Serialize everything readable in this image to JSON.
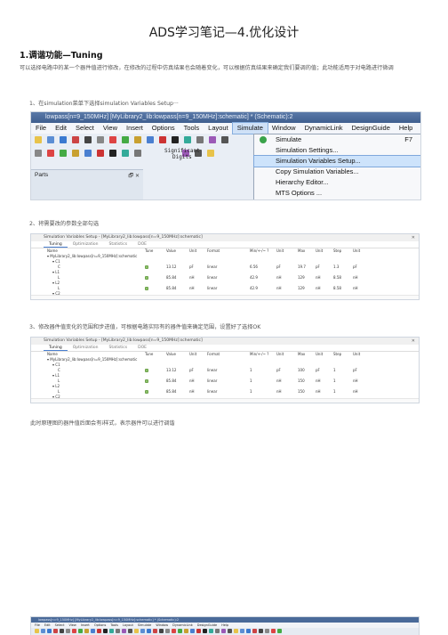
{
  "document": {
    "title": "ADS学习笔记—4.优化设计",
    "section1_heading": "1.调谐功能—Tuning",
    "intro": "可以选择电路中的某一个器件值进行修改，在修改的过程中仿真结果也会随着变化，可以根据仿真结果来确定我们要调的值；此功能适用于对电路进行微调",
    "step1": "1、在simulation菜单下选择simulation Variables Setup···",
    "step2": "2、将需要改的参数全部勾选",
    "step3": "3、修改器件值变化的范围和步进值，可根据电路实际有的器件值来确定范围，设置好了选择OK",
    "note4": "此时原理图的器件值后面会有i样式，表示器件可以进行调谐"
  },
  "screenshot1": {
    "window_title": "lowpass[n=9_150MHz] [MyLibrary2_lib:lowpass[n=9_150MHz]:schematic] * (Schematic):2",
    "menus": [
      "File",
      "Edit",
      "Select",
      "View",
      "Insert",
      "Options",
      "Tools",
      "Layout",
      "Simulate",
      "Window",
      "DynamicLink",
      "DesignGuide",
      "Help"
    ],
    "active_menu": "Simulate",
    "significant_digits": [
      "Significant",
      "Digits"
    ],
    "parts_label": "Parts",
    "parts_controls": "🗗 ✕",
    "simulate_menu": [
      {
        "label": "Simulate",
        "shortcut": "F7"
      },
      {
        "label": "Simulation Settings...",
        "shortcut": ""
      },
      {
        "label": "Simulation Variables Setup...",
        "shortcut": ""
      },
      {
        "label": "Copy Simulation Variables...",
        "shortcut": ""
      },
      {
        "label": "Hierarchy Editor...",
        "shortcut": ""
      },
      {
        "label": "MTS Options ...",
        "shortcut": ""
      }
    ],
    "highlighted_item": "Simulation Variables Setup..."
  },
  "dialog": {
    "title": "Simulation Variables Setup - [MyLibrary2_lib:lowpass[n=9_150MHz]:schematic]",
    "tabs": [
      "Tuning",
      "Optimization",
      "Statistics",
      "DOE"
    ],
    "active_tab": "Tuning",
    "columns": [
      "Name",
      "Tune",
      "Value",
      "Unit",
      "Format",
      "Min/+-/~ ?",
      "Unit",
      "Max",
      "Unit",
      "Step",
      "Unit"
    ],
    "tree_root": "MyLibrary2_lib:lowpass[n=9_150MHz]:schematic"
  },
  "screenshot2": {
    "rows": [
      {
        "name": "C1",
        "indent": 1,
        "tune": null,
        "value": "",
        "unit": "",
        "format": "",
        "min": "",
        "minunit": "",
        "max": "",
        "maxunit": "",
        "step": "",
        "stepunit": ""
      },
      {
        "name": "C",
        "indent": 2,
        "tune": true,
        "value": "13.12",
        "unit": "pF",
        "format": "linear",
        "min": "6.56",
        "minunit": "pF",
        "max": "19.7",
        "maxunit": "pF",
        "step": "1.3",
        "stepunit": "pF"
      },
      {
        "name": "L1",
        "indent": 1,
        "tune": null,
        "value": "",
        "unit": "",
        "format": "",
        "min": "",
        "minunit": "",
        "max": "",
        "maxunit": "",
        "step": "",
        "stepunit": ""
      },
      {
        "name": "L",
        "indent": 2,
        "tune": true,
        "value": "85.84",
        "unit": "nH",
        "format": "linear",
        "min": "42.9",
        "minunit": "nH",
        "max": "129",
        "maxunit": "nH",
        "step": "8.58",
        "stepunit": "nH"
      },
      {
        "name": "L2",
        "indent": 1,
        "tune": null,
        "value": "",
        "unit": "",
        "format": "",
        "min": "",
        "minunit": "",
        "max": "",
        "maxunit": "",
        "step": "",
        "stepunit": ""
      },
      {
        "name": "L",
        "indent": 2,
        "tune": true,
        "value": "85.84",
        "unit": "nH",
        "format": "linear",
        "min": "42.9",
        "minunit": "nH",
        "max": "129",
        "maxunit": "nH",
        "step": "8.58",
        "stepunit": "nH"
      },
      {
        "name": "C2",
        "indent": 1,
        "tune": null,
        "value": "",
        "unit": "",
        "format": "",
        "min": "",
        "minunit": "",
        "max": "",
        "maxunit": "",
        "step": "",
        "stepunit": ""
      },
      {
        "name": "C",
        "indent": 2,
        "tune": true,
        "value": "42.44",
        "unit": "pF",
        "format": "linear",
        "min": "21.2",
        "minunit": "pF",
        "max": "63.7",
        "maxunit": "pF",
        "step": "4.24",
        "stepunit": "pF"
      },
      {
        "name": "C3",
        "indent": 1,
        "tune": null,
        "value": "",
        "unit": "",
        "format": "",
        "min": "",
        "minunit": "",
        "max": "",
        "maxunit": "",
        "step": "",
        "stepunit": ""
      },
      {
        "name": "C",
        "indent": 2,
        "tune": true,
        "value": "13.12",
        "unit": "pF",
        "format": "linear",
        "min": "6.56",
        "minunit": "pF",
        "max": "19.7",
        "maxunit": "pF",
        "step": "1.31",
        "stepunit": "pF"
      },
      {
        "name": "Term1",
        "indent": 1,
        "tune": null,
        "value": "",
        "unit": "",
        "format": "",
        "min": "",
        "minunit": "",
        "max": "",
        "maxunit": "",
        "step": "",
        "stepunit": ""
      },
      {
        "name": "Z",
        "indent": 2,
        "tune": false,
        "value": "50",
        "unit": "Ohm",
        "format": "linear",
        "min": "",
        "minunit": "",
        "max": "",
        "maxunit": "",
        "step": "",
        "stepunit": ""
      },
      {
        "name": "Term2",
        "indent": 1,
        "tune": null,
        "value": "",
        "unit": "",
        "format": "",
        "min": "",
        "minunit": "",
        "max": "",
        "maxunit": "",
        "step": "",
        "stepunit": ""
      },
      {
        "name": "Z",
        "indent": 2,
        "tune": false,
        "value": "50",
        "unit": "Ohm",
        "format": "linear",
        "min": "",
        "minunit": "",
        "max": "",
        "maxunit": "",
        "step": "",
        "stepunit": ""
      }
    ]
  },
  "screenshot3": {
    "selected_row": 9,
    "rows": [
      {
        "name": "C1",
        "indent": 1,
        "tune": null,
        "value": "",
        "unit": "",
        "format": "",
        "min": "",
        "minunit": "",
        "max": "",
        "maxunit": "",
        "step": "",
        "stepunit": ""
      },
      {
        "name": "C",
        "indent": 2,
        "tune": true,
        "value": "13.12",
        "unit": "pF",
        "format": "linear",
        "min": "1",
        "minunit": "pF",
        "max": "100",
        "maxunit": "pF",
        "step": "1",
        "stepunit": "pF"
      },
      {
        "name": "L1",
        "indent": 1,
        "tune": null,
        "value": "",
        "unit": "",
        "format": "",
        "min": "",
        "minunit": "",
        "max": "",
        "maxunit": "",
        "step": "",
        "stepunit": ""
      },
      {
        "name": "L",
        "indent": 2,
        "tune": true,
        "value": "85.84",
        "unit": "nH",
        "format": "linear",
        "min": "1",
        "minunit": "nH",
        "max": "150",
        "maxunit": "nH",
        "step": "1",
        "stepunit": "nH"
      },
      {
        "name": "L2",
        "indent": 1,
        "tune": null,
        "value": "",
        "unit": "",
        "format": "",
        "min": "",
        "minunit": "",
        "max": "",
        "maxunit": "",
        "step": "",
        "stepunit": ""
      },
      {
        "name": "L",
        "indent": 2,
        "tune": true,
        "value": "85.84",
        "unit": "nH",
        "format": "linear",
        "min": "1",
        "minunit": "nH",
        "max": "150",
        "maxunit": "nH",
        "step": "1",
        "stepunit": "nH"
      },
      {
        "name": "C2",
        "indent": 1,
        "tune": null,
        "value": "",
        "unit": "",
        "format": "",
        "min": "",
        "minunit": "",
        "max": "",
        "maxunit": "",
        "step": "",
        "stepunit": ""
      },
      {
        "name": "C",
        "indent": 2,
        "tune": true,
        "value": "42.44",
        "unit": "pF",
        "format": "linear",
        "min": "1",
        "minunit": "pF",
        "max": "100",
        "maxunit": "pF",
        "step": "1",
        "stepunit": "pF"
      },
      {
        "name": "C3",
        "indent": 1,
        "tune": null,
        "value": "",
        "unit": "",
        "format": "",
        "min": "",
        "minunit": "",
        "max": "",
        "maxunit": "",
        "step": "",
        "stepunit": ""
      },
      {
        "name": "C",
        "indent": 2,
        "tune": true,
        "value": "13.12",
        "unit": "pF",
        "format": "linear",
        "min": "1",
        "minunit": "pF",
        "max": "100",
        "maxunit": "pF",
        "step": "1",
        "stepunit": "pF"
      },
      {
        "name": "Term1",
        "indent": 1,
        "tune": null,
        "value": "",
        "unit": "",
        "format": "",
        "min": "",
        "minunit": "",
        "max": "",
        "maxunit": "",
        "step": "",
        "stepunit": ""
      },
      {
        "name": "Z",
        "indent": 2,
        "tune": false,
        "value": "50",
        "unit": "Ohm",
        "format": "linear",
        "min": "",
        "minunit": "",
        "max": "",
        "maxunit": "",
        "step": "",
        "stepunit": ""
      },
      {
        "name": "Term2",
        "indent": 1,
        "tune": null,
        "value": "",
        "unit": "",
        "format": "",
        "min": "",
        "minunit": "",
        "max": "",
        "maxunit": "",
        "step": "",
        "stepunit": ""
      },
      {
        "name": "Z",
        "indent": 2,
        "tune": false,
        "value": "50",
        "unit": "Ohm",
        "format": "linear",
        "min": "",
        "minunit": "",
        "max": "",
        "maxunit": "",
        "step": "",
        "stepunit": ""
      }
    ]
  },
  "screenshot4": {
    "window_title": "lowpass[n=9_150MHz] [MyLibrary2_lib:lowpass[n=9_150MHz]:schematic] * (Schematic):2",
    "menus": [
      "File",
      "Edit",
      "Select",
      "View",
      "Insert",
      "Options",
      "Tools",
      "Layout",
      "Simulate",
      "Window",
      "DynamicLink",
      "DesignGuide",
      "Help"
    ]
  }
}
